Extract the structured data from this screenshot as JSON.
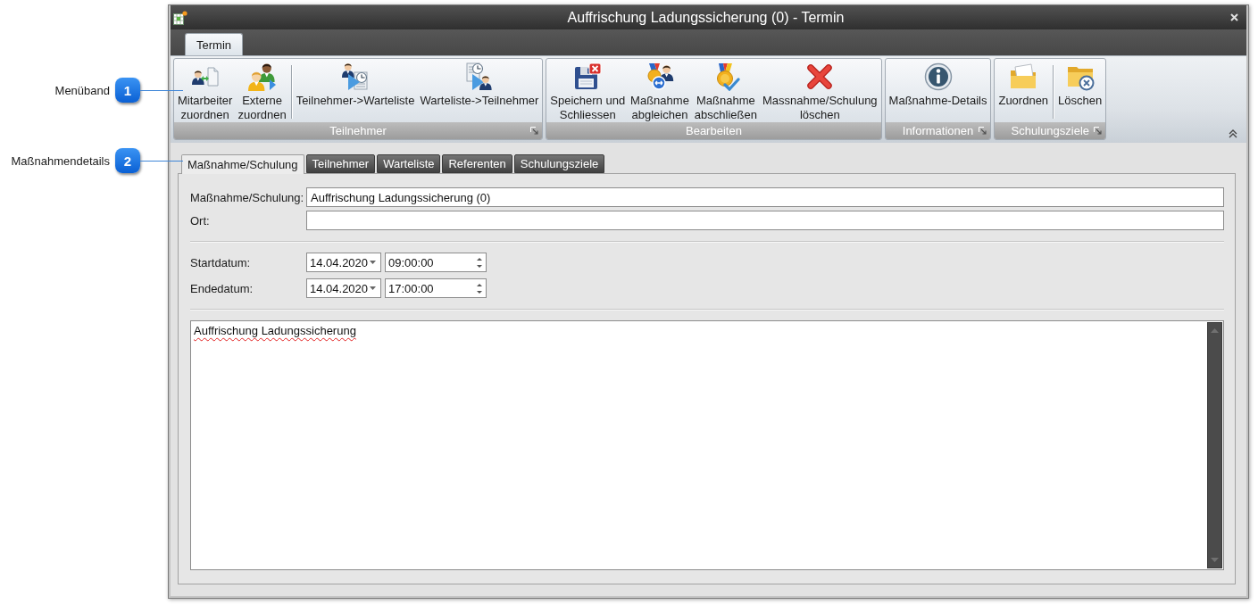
{
  "callouts": [
    {
      "number": "1",
      "label": "Menüband"
    },
    {
      "number": "2",
      "label": "Maßnahmendetails"
    }
  ],
  "window": {
    "title": "Auffrischung Ladungssicherung (0) - Termin"
  },
  "ribbon": {
    "tabs": [
      {
        "label": "Termin",
        "selected": true
      }
    ],
    "groups": [
      {
        "label": "Teilnehmer",
        "launcher": true,
        "sections": [
          {
            "buttons": [
              {
                "lines": [
                  "Mitarbeiter",
                  "zuordnen"
                ]
              },
              {
                "lines": [
                  "Externe",
                  "zuordnen"
                ]
              }
            ]
          },
          {
            "buttons": [
              {
                "lines": [
                  "Teilnehmer->Warteliste"
                ]
              },
              {
                "lines": [
                  "Warteliste->Teilnehmer"
                ]
              }
            ]
          }
        ]
      },
      {
        "label": "Bearbeiten",
        "launcher": false,
        "sections": [
          {
            "buttons": [
              {
                "lines": [
                  "Speichern und",
                  "Schliessen"
                ]
              },
              {
                "lines": [
                  "Maßnahme",
                  "abgleichen"
                ]
              },
              {
                "lines": [
                  "Maßnahme",
                  "abschließen"
                ]
              },
              {
                "lines": [
                  "Massnahme/Schulung",
                  "löschen"
                ]
              }
            ]
          }
        ]
      },
      {
        "label": "Informationen",
        "launcher": true,
        "sections": [
          {
            "buttons": [
              {
                "lines": [
                  "Maßnahme-Details"
                ]
              }
            ]
          }
        ]
      },
      {
        "label": "Schulungsziele",
        "launcher": true,
        "sections": [
          {
            "buttons": [
              {
                "lines": [
                  "Zuordnen"
                ]
              }
            ]
          },
          {
            "buttons": [
              {
                "lines": [
                  "Löschen"
                ]
              }
            ]
          }
        ]
      }
    ]
  },
  "tabs": [
    {
      "label": "Maßnahme/Schulung",
      "selected": true
    },
    {
      "label": "Teilnehmer",
      "selected": false
    },
    {
      "label": "Warteliste",
      "selected": false
    },
    {
      "label": "Referenten",
      "selected": false
    },
    {
      "label": "Schulungsziele",
      "selected": false
    }
  ],
  "form": {
    "fields": [
      {
        "label": "Maßnahme/Schulung:",
        "value": "Auffrischung Ladungssicherung (0)"
      },
      {
        "label": "Ort:"
      }
    ],
    "dates": [
      {
        "label": "Startdatum:",
        "date": "14.04.2020",
        "time": "09:00:00"
      },
      {
        "label": "Endedatum:",
        "date": "14.04.2020",
        "time": "17:00:00"
      }
    ],
    "notes": {
      "text": "Auffrischung Ladungssicherung",
      "spelling_flagged": true
    }
  }
}
